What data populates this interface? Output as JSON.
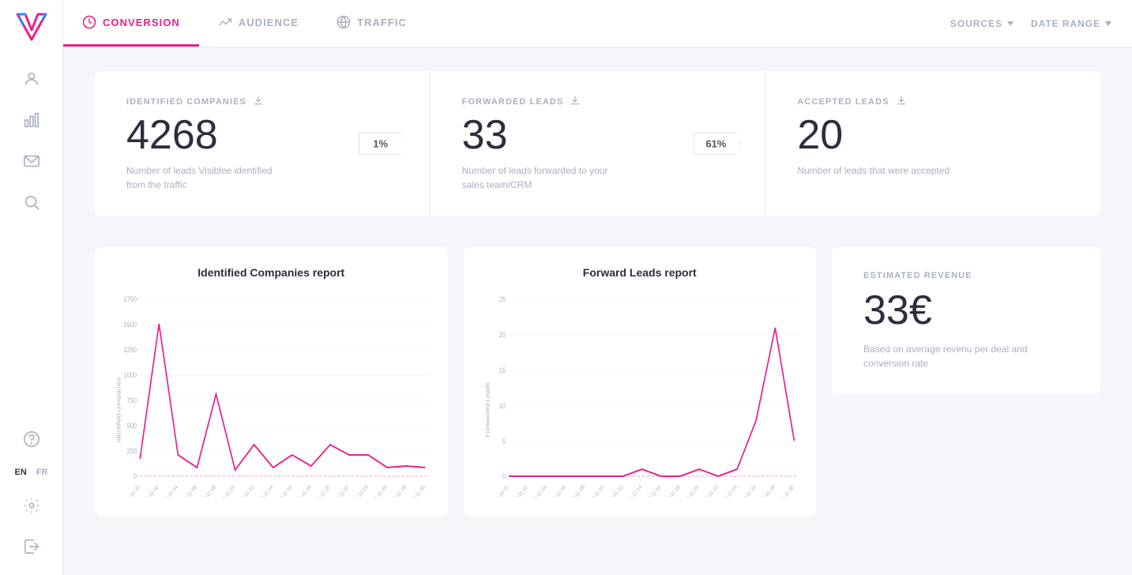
{
  "sidebar": {
    "logo_alt": "Visiblee logo",
    "lang_en": "EN",
    "lang_fr": "FR",
    "active_lang": "EN",
    "icons": [
      "user-icon",
      "chart-icon",
      "mail-icon",
      "search-icon",
      "question-icon",
      "settings-icon",
      "logout-icon"
    ]
  },
  "topnav": {
    "tabs": [
      {
        "id": "conversion",
        "label": "CONVERSION",
        "active": true
      },
      {
        "id": "audience",
        "label": "AUDIENCE",
        "active": false
      },
      {
        "id": "traffic",
        "label": "TRAFFIC",
        "active": false
      }
    ],
    "sources_label": "SOURCES",
    "date_range_label": "DATE RANGE"
  },
  "stats": {
    "identified_companies": {
      "label": "IDENTIFIED COMPANIES",
      "value": "4268",
      "description": "Number of leads Visiblee identified from the traffic",
      "badge": "1%"
    },
    "forwarded_leads": {
      "label": "FORWARDED LEADS",
      "value": "33",
      "description": "Number of leads forwarded to your sales team/CRM",
      "badge": "61%"
    },
    "accepted_leads": {
      "label": "ACCEPTED LEADS",
      "value": "20",
      "description": "Number of leads that were accepted"
    }
  },
  "charts": {
    "identified_companies_report": {
      "title": "Identified Companies report",
      "y_label": "Identified companies",
      "x_labels": [
        "2017-10-31",
        "2017-11-02",
        "2017-11-04",
        "2017-11-06",
        "2017-11-08",
        "2017-11-10",
        "2017-11-12",
        "2017-11-14",
        "2017-11-16",
        "2017-11-18",
        "2017-11-20",
        "2017-11-22",
        "2017-11-24",
        "2017-11-26",
        "2017-11-28",
        "2017-11-30"
      ],
      "y_ticks": [
        "0",
        "250",
        "500",
        "750",
        "1000",
        "1250",
        "1500",
        "1750"
      ],
      "data_points": [
        150,
        1450,
        200,
        80,
        800,
        60,
        350,
        80,
        200,
        100,
        350,
        200,
        200,
        80,
        100,
        80
      ]
    },
    "forward_leads_report": {
      "title": "Forward Leads report",
      "y_label": "Forwarded Leads",
      "x_labels": [
        "2017-10-31",
        "2017-11-02",
        "2017-11-04",
        "2017-11-06",
        "2017-11-08",
        "2017-11-10",
        "2017-11-12",
        "2017-11-14",
        "2017-11-16",
        "2017-11-18",
        "2017-11-20",
        "2017-11-22",
        "2017-11-24",
        "2017-11-26",
        "2017-11-28",
        "2017-11-30"
      ],
      "y_ticks": [
        "0",
        "5",
        "10",
        "15",
        "20",
        "25"
      ],
      "data_points": [
        0,
        0,
        0,
        0,
        0,
        0,
        0,
        1,
        0,
        0,
        1,
        0,
        1,
        8,
        21,
        5
      ]
    }
  },
  "revenue": {
    "label": "ESTIMATED REVENUE",
    "value": "33€",
    "description": "Based on average revenu per deal and conversion rate"
  }
}
